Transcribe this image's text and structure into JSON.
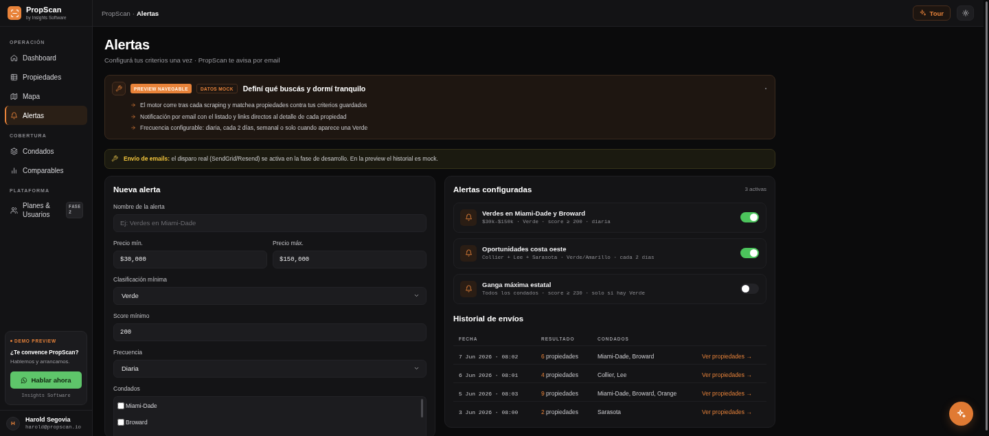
{
  "sidebar": {
    "brand": {
      "name": "PropScan",
      "tagline": "by Insights Software"
    },
    "sections": [
      {
        "title": "OPERACIÓN",
        "items": [
          {
            "label": "Dashboard",
            "selected": false
          },
          {
            "label": "Propiedades",
            "selected": false
          },
          {
            "label": "Mapa",
            "selected": false
          },
          {
            "label": "Alertas",
            "selected": true
          }
        ]
      },
      {
        "title": "COBERTURA",
        "items": [
          {
            "label": "Condados",
            "selected": false
          },
          {
            "label": "Comparables",
            "selected": false
          }
        ]
      },
      {
        "title": "PLATAFORMA",
        "items": [
          {
            "label": "Planes & Usuarios",
            "selected": false,
            "badge": "FASE 2"
          }
        ]
      }
    ],
    "promo": {
      "eyebrow": "DEMO PREVIEW",
      "title": "¿Te convence PropScan?",
      "text": "Hablemos y arrancamos.",
      "button": "Hablar ahora",
      "footer": "Insights Software"
    },
    "user": {
      "initial": "H",
      "name": "Harold Segovia",
      "email": "harold@propscan.io"
    }
  },
  "topbar": {
    "breadcrumb": [
      "PropScan",
      "Alertas"
    ],
    "separator": "·",
    "tour_button": "Tour"
  },
  "page": {
    "title": "Alertas",
    "subtitle": "Configurá tus criterios una vez · PropScan te avisa por email"
  },
  "intro": {
    "badges": [
      {
        "label": "PREVIEW NAVEGABLE",
        "kind": "filled"
      },
      {
        "label": "DATOS MOCK",
        "kind": "outline"
      }
    ],
    "title": "Definí qué buscás y dormí tranquilo",
    "points": [
      "El motor corre tras cada scraping y matchea propiedades contra tus criterios guardados",
      "Notificación por email con el listado y links directos al detalle de cada propiedad",
      "Frecuencia configurable: diaria, cada 2 días, semanal o solo cuando aparece una Verde"
    ]
  },
  "notice": {
    "text": "**Envío de emails:** el disparo real (SendGrid/Resend) se activa en la fase de desarrollo. En la preview el historial es mock."
  },
  "form": {
    "title": "Nueva alerta",
    "rows": [
      {
        "fields": [
          {
            "kind": "text",
            "label": "Nombre de la alerta",
            "placeholder": "Ej: Verdes en Miami-Dade"
          }
        ]
      },
      {
        "fields": [
          {
            "kind": "number",
            "label": "Precio mín.",
            "value": "$30,000"
          },
          {
            "kind": "number",
            "label": "Precio máx.",
            "value": "$150,000"
          }
        ]
      },
      {
        "fields": [
          {
            "kind": "select",
            "label": "Clasificación mínima",
            "value": "Verde"
          }
        ]
      },
      {
        "fields": [
          {
            "kind": "number",
            "label": "Score mínimo",
            "value": "200"
          }
        ]
      },
      {
        "fields": [
          {
            "kind": "select",
            "label": "Frecuencia",
            "value": "Diaria"
          }
        ]
      },
      {
        "fields": [
          {
            "kind": "checklist",
            "label": "Condados",
            "options": [
              {
                "label": "Miami-Dade",
                "checked": false
              },
              {
                "label": "Broward",
                "checked": false
              }
            ]
          }
        ]
      }
    ]
  },
  "alerts": {
    "title": "Alertas configuradas",
    "count": "3 activas",
    "items": [
      {
        "name": "Verdes en Miami-Dade y Broward",
        "details": "$30k-$150k · Verde · score ≥ 200 · diaria",
        "on": true
      },
      {
        "name": "Oportunidades costa oeste",
        "details": "Collier + Lee + Sarasota · Verde/Amarillo · cada 2 días",
        "on": true
      },
      {
        "name": "Ganga máxima estatal",
        "details": "Todos los condados · score ≥ 230 · solo si hay Verde",
        "on": false
      }
    ]
  },
  "history": {
    "title": "Historial de envíos",
    "columns": [
      "FECHA",
      "RESULTADO",
      "CONDADOS"
    ],
    "rows": [
      {
        "date": "7 Jun 2026 · 08:02",
        "count": "6",
        "unit": "propiedades",
        "counties": "Miami-Dade, Broward",
        "link": "Ver propiedades →"
      },
      {
        "date": "6 Jun 2026 · 08:01",
        "count": "4",
        "unit": "propiedades",
        "counties": "Collier, Lee",
        "link": "Ver propiedades →"
      },
      {
        "date": "5 Jun 2026 · 08:03",
        "count": "9",
        "unit": "propiedades",
        "counties": "Miami-Dade, Broward, Orange",
        "link": "Ver propiedades →"
      },
      {
        "date": "3 Jun 2026 · 08:00",
        "count": "2",
        "unit": "propiedades",
        "counties": "Sarasota",
        "link": "Ver propiedades →"
      }
    ]
  }
}
